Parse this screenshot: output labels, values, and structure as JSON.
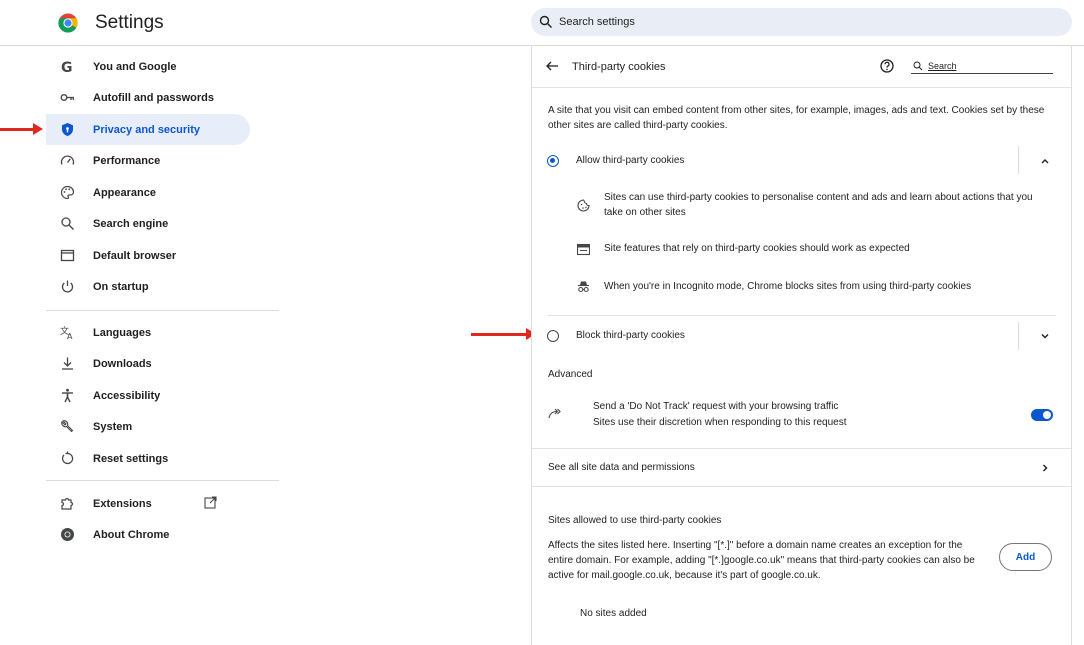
{
  "header": {
    "app_title": "Settings",
    "search_placeholder": "Search settings"
  },
  "sidebar": {
    "items": [
      {
        "label": "You and Google",
        "icon": "google-g-icon"
      },
      {
        "label": "Autofill and passwords",
        "icon": "key-icon"
      },
      {
        "label": "Privacy and security",
        "icon": "shield-icon",
        "active": true
      },
      {
        "label": "Performance",
        "icon": "speedometer-icon"
      },
      {
        "label": "Appearance",
        "icon": "palette-icon"
      },
      {
        "label": "Search engine",
        "icon": "search-icon"
      },
      {
        "label": "Default browser",
        "icon": "browser-window-icon"
      },
      {
        "label": "On startup",
        "icon": "power-icon"
      },
      {
        "label": "Languages",
        "icon": "translate-icon"
      },
      {
        "label": "Downloads",
        "icon": "download-icon"
      },
      {
        "label": "Accessibility",
        "icon": "accessibility-icon"
      },
      {
        "label": "System",
        "icon": "wrench-icon"
      },
      {
        "label": "Reset settings",
        "icon": "reset-icon"
      },
      {
        "label": "Extensions",
        "icon": "puzzle-icon"
      },
      {
        "label": "About Chrome",
        "icon": "chrome-icon"
      }
    ]
  },
  "page": {
    "title": "Third-party cookies",
    "search_label": "Search",
    "intro": "A site that you visit can embed content from other sites, for example, images, ads and text. Cookies set by these other sites are called third-party cookies.",
    "allow_label": "Allow third-party cookies",
    "allow_details": [
      "Sites can use third-party cookies to personalise content and ads and learn about actions that you take on other sites",
      "Site features that rely on third-party cookies should work as expected",
      "When you're in Incognito mode, Chrome blocks sites from using third-party cookies"
    ],
    "block_label": "Block third-party cookies",
    "advanced_heading": "Advanced",
    "dnt_title": "Send a 'Do Not Track' request with your browsing traffic",
    "dnt_subtitle": "Sites use their discretion when responding to this request",
    "dnt_enabled": true,
    "see_all_label": "See all site data and permissions",
    "allowed_heading": "Sites allowed to use third-party cookies",
    "allowed_desc": "Affects the sites listed here. Inserting \"[*.]\" before a domain name creates an exception for the entire domain. For example, adding \"[*.]google.co.uk\" means that third-party cookies can also be active for mail.google.co.uk, because it's part of google.co.uk.",
    "add_label": "Add",
    "no_sites": "No sites added"
  },
  "colors": {
    "accent": "#0b57d0",
    "active_bg": "#e8eef9",
    "annotation_arrow": "#e0281f"
  }
}
